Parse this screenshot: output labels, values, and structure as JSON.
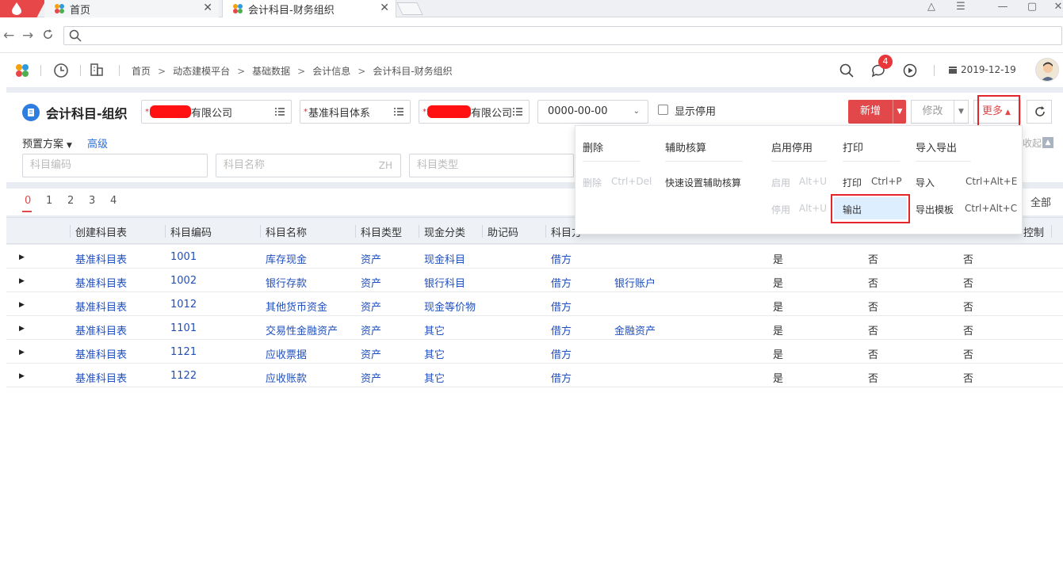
{
  "browser": {
    "tabs": [
      {
        "label": "首页"
      },
      {
        "label": "会计科目-财务组织"
      }
    ],
    "url": ""
  },
  "header": {
    "breadcrumb": [
      "首页",
      "动态建模平台",
      "基础数据",
      "会计信息",
      "会计科目-财务组织"
    ],
    "message_badge": "4",
    "date": "2019-12-19"
  },
  "page": {
    "title": "会计科目-组织",
    "org_select": {
      "value": "有限公司"
    },
    "system_select": {
      "value": "基准科目体系"
    },
    "org_select2": {
      "value": "有限公司"
    },
    "date_select": {
      "value": "0000-00-00"
    },
    "show_disabled_label": "显示停用",
    "buttons": {
      "add": "新增",
      "edit": "修改",
      "more": "更多"
    },
    "preset_label": "预置方案",
    "advanced_label": "高级",
    "collapse_label": "收起",
    "filters": {
      "code_placeholder": "科目编码",
      "name_placeholder": "科目名称",
      "name_suffix": "ZH",
      "type_placeholder": "科目类型"
    }
  },
  "pagination": {
    "levels": [
      "0",
      "1",
      "2",
      "3",
      "4"
    ],
    "active": "0",
    "all_label": "全部"
  },
  "table": {
    "columns": [
      "创建科目表",
      "科目编码",
      "科目名称",
      "科目类型",
      "现金分类",
      "助记码",
      "科目方",
      "控制"
    ],
    "rows": [
      {
        "table": "基准科目表",
        "code": "1001",
        "name": "库存现金",
        "type": "资产",
        "cash": "现金科目",
        "dir": "借方",
        "aux": "",
        "c1": "是",
        "c2": "否",
        "c3": "否"
      },
      {
        "table": "基准科目表",
        "code": "1002",
        "name": "银行存款",
        "type": "资产",
        "cash": "银行科目",
        "dir": "借方",
        "aux": "银行账户",
        "c1": "是",
        "c2": "否",
        "c3": "否"
      },
      {
        "table": "基准科目表",
        "code": "1012",
        "name": "其他货币资金",
        "type": "资产",
        "cash": "现金等价物",
        "dir": "借方",
        "aux": "",
        "c1": "是",
        "c2": "否",
        "c3": "否"
      },
      {
        "table": "基准科目表",
        "code": "1101",
        "name": "交易性金融资产",
        "type": "资产",
        "cash": "其它",
        "dir": "借方",
        "aux": "金融资产",
        "c1": "是",
        "c2": "否",
        "c3": "否"
      },
      {
        "table": "基准科目表",
        "code": "1121",
        "name": "应收票据",
        "type": "资产",
        "cash": "其它",
        "dir": "借方",
        "aux": "",
        "c1": "是",
        "c2": "否",
        "c3": "否"
      },
      {
        "table": "基准科目表",
        "code": "1122",
        "name": "应收账款",
        "type": "资产",
        "cash": "其它",
        "dir": "借方",
        "aux": "",
        "c1": "是",
        "c2": "否",
        "c3": "否"
      }
    ]
  },
  "more_menu": {
    "groups": {
      "delete": {
        "title": "删除",
        "item": "删除",
        "key": "Ctrl+Del"
      },
      "aux": {
        "title": "辅助核算",
        "item": "快速设置辅助核算"
      },
      "toggle": {
        "title": "启用停用",
        "enable": "启用",
        "enable_key": "Alt+U",
        "disable": "停用",
        "disable_key": "Alt+U"
      },
      "print": {
        "title": "打印",
        "item": "打印",
        "key": "Ctrl+P",
        "output": "输出"
      },
      "io": {
        "title": "导入导出",
        "import": "导入",
        "import_key": "Ctrl+Alt+E",
        "export_tpl": "导出模板",
        "export_tpl_key": "Ctrl+Alt+C"
      }
    }
  }
}
